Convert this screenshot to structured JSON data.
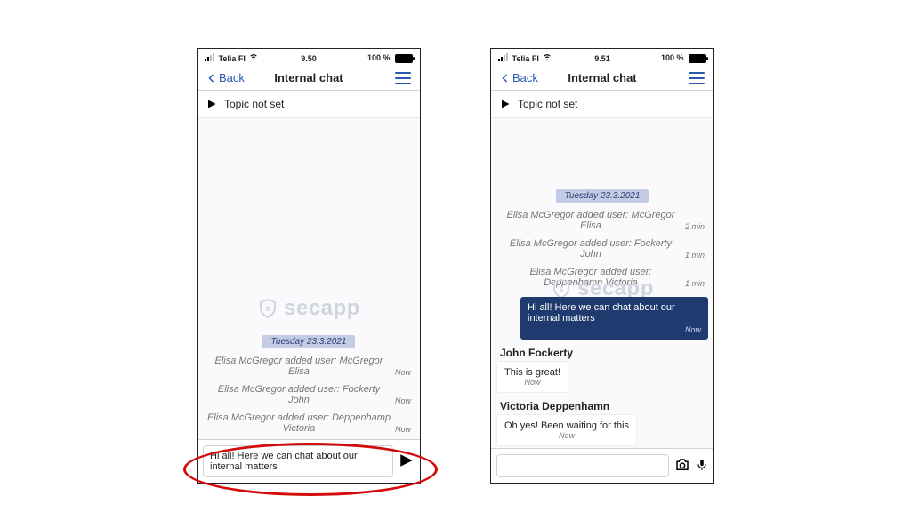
{
  "watermark": "secapp",
  "left": {
    "status": {
      "carrier": "Telia FI",
      "time": "9.50",
      "battery": "100 %"
    },
    "nav": {
      "back": "Back",
      "title": "Internal chat"
    },
    "topic": "Topic not set",
    "date": "Tuesday 23.3.2021",
    "system": [
      {
        "text": "Elisa McGregor added user: McGregor Elisa",
        "time": "Now"
      },
      {
        "text": "Elisa McGregor added user: Fockerty John",
        "time": "Now"
      },
      {
        "text": "Elisa McGregor added user: Deppenhamp Victoria",
        "time": "Now"
      }
    ],
    "composer": {
      "value": "Hi all! Here we can chat about our internal matters"
    }
  },
  "right": {
    "status": {
      "carrier": "Telia FI",
      "time": "9.51",
      "battery": "100 %"
    },
    "nav": {
      "back": "Back",
      "title": "Internal chat"
    },
    "topic": "Topic not set",
    "date": "Tuesday 23.3.2021",
    "system": [
      {
        "text": "Elisa McGregor added user: McGregor Elisa",
        "time": "2 min"
      },
      {
        "text": "Elisa McGregor added user: Fockerty John",
        "time": "1 min"
      },
      {
        "text": "Elisa McGregor added user: Deppenhamn Victoria",
        "time": "1 min"
      }
    ],
    "outgoing": {
      "text": "Hi all! Here we can chat about our internal matters",
      "time": "Now"
    },
    "incoming": [
      {
        "sender": "John Fockerty",
        "text": "This is great!",
        "time": "Now"
      },
      {
        "sender": "Victoria Deppenhamn",
        "text": "Oh yes! Been waiting for this",
        "time": "Now"
      }
    ],
    "composer": {
      "placeholder": ""
    }
  }
}
